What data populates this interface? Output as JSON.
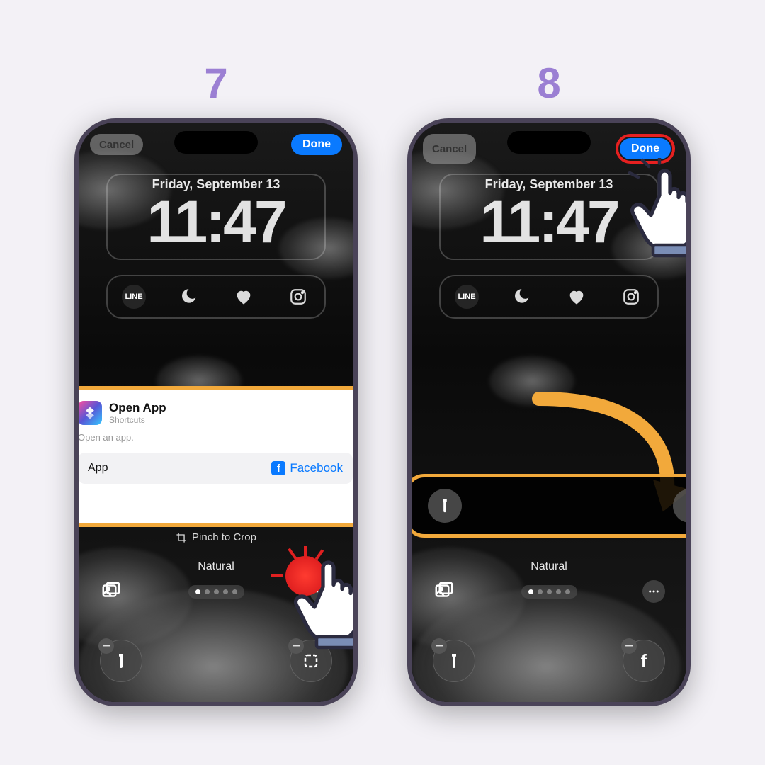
{
  "steps": {
    "left": "7",
    "right": "8"
  },
  "header": {
    "cancel": "Cancel",
    "done": "Done"
  },
  "lockscreen": {
    "date": "Friday, September 13",
    "time": "11:47"
  },
  "widgets": {
    "line": "LINE",
    "dnd": "moon-icon",
    "heart": "heart-icon",
    "ig": "instagram-icon"
  },
  "popup": {
    "title": "Open App",
    "subtitle": "Shortcuts",
    "description": "Open an app.",
    "row_label": "App",
    "row_value": "Facebook"
  },
  "pinch": "Pinch to Crop",
  "filter": {
    "name": "Natural"
  },
  "quick": {
    "left": "flashlight",
    "right_7": "scan",
    "right_8": "facebook"
  },
  "colors": {
    "accent": "#f2a93b",
    "red": "#e62020",
    "blue": "#0a7aff",
    "purple": "#9b7fd3"
  }
}
